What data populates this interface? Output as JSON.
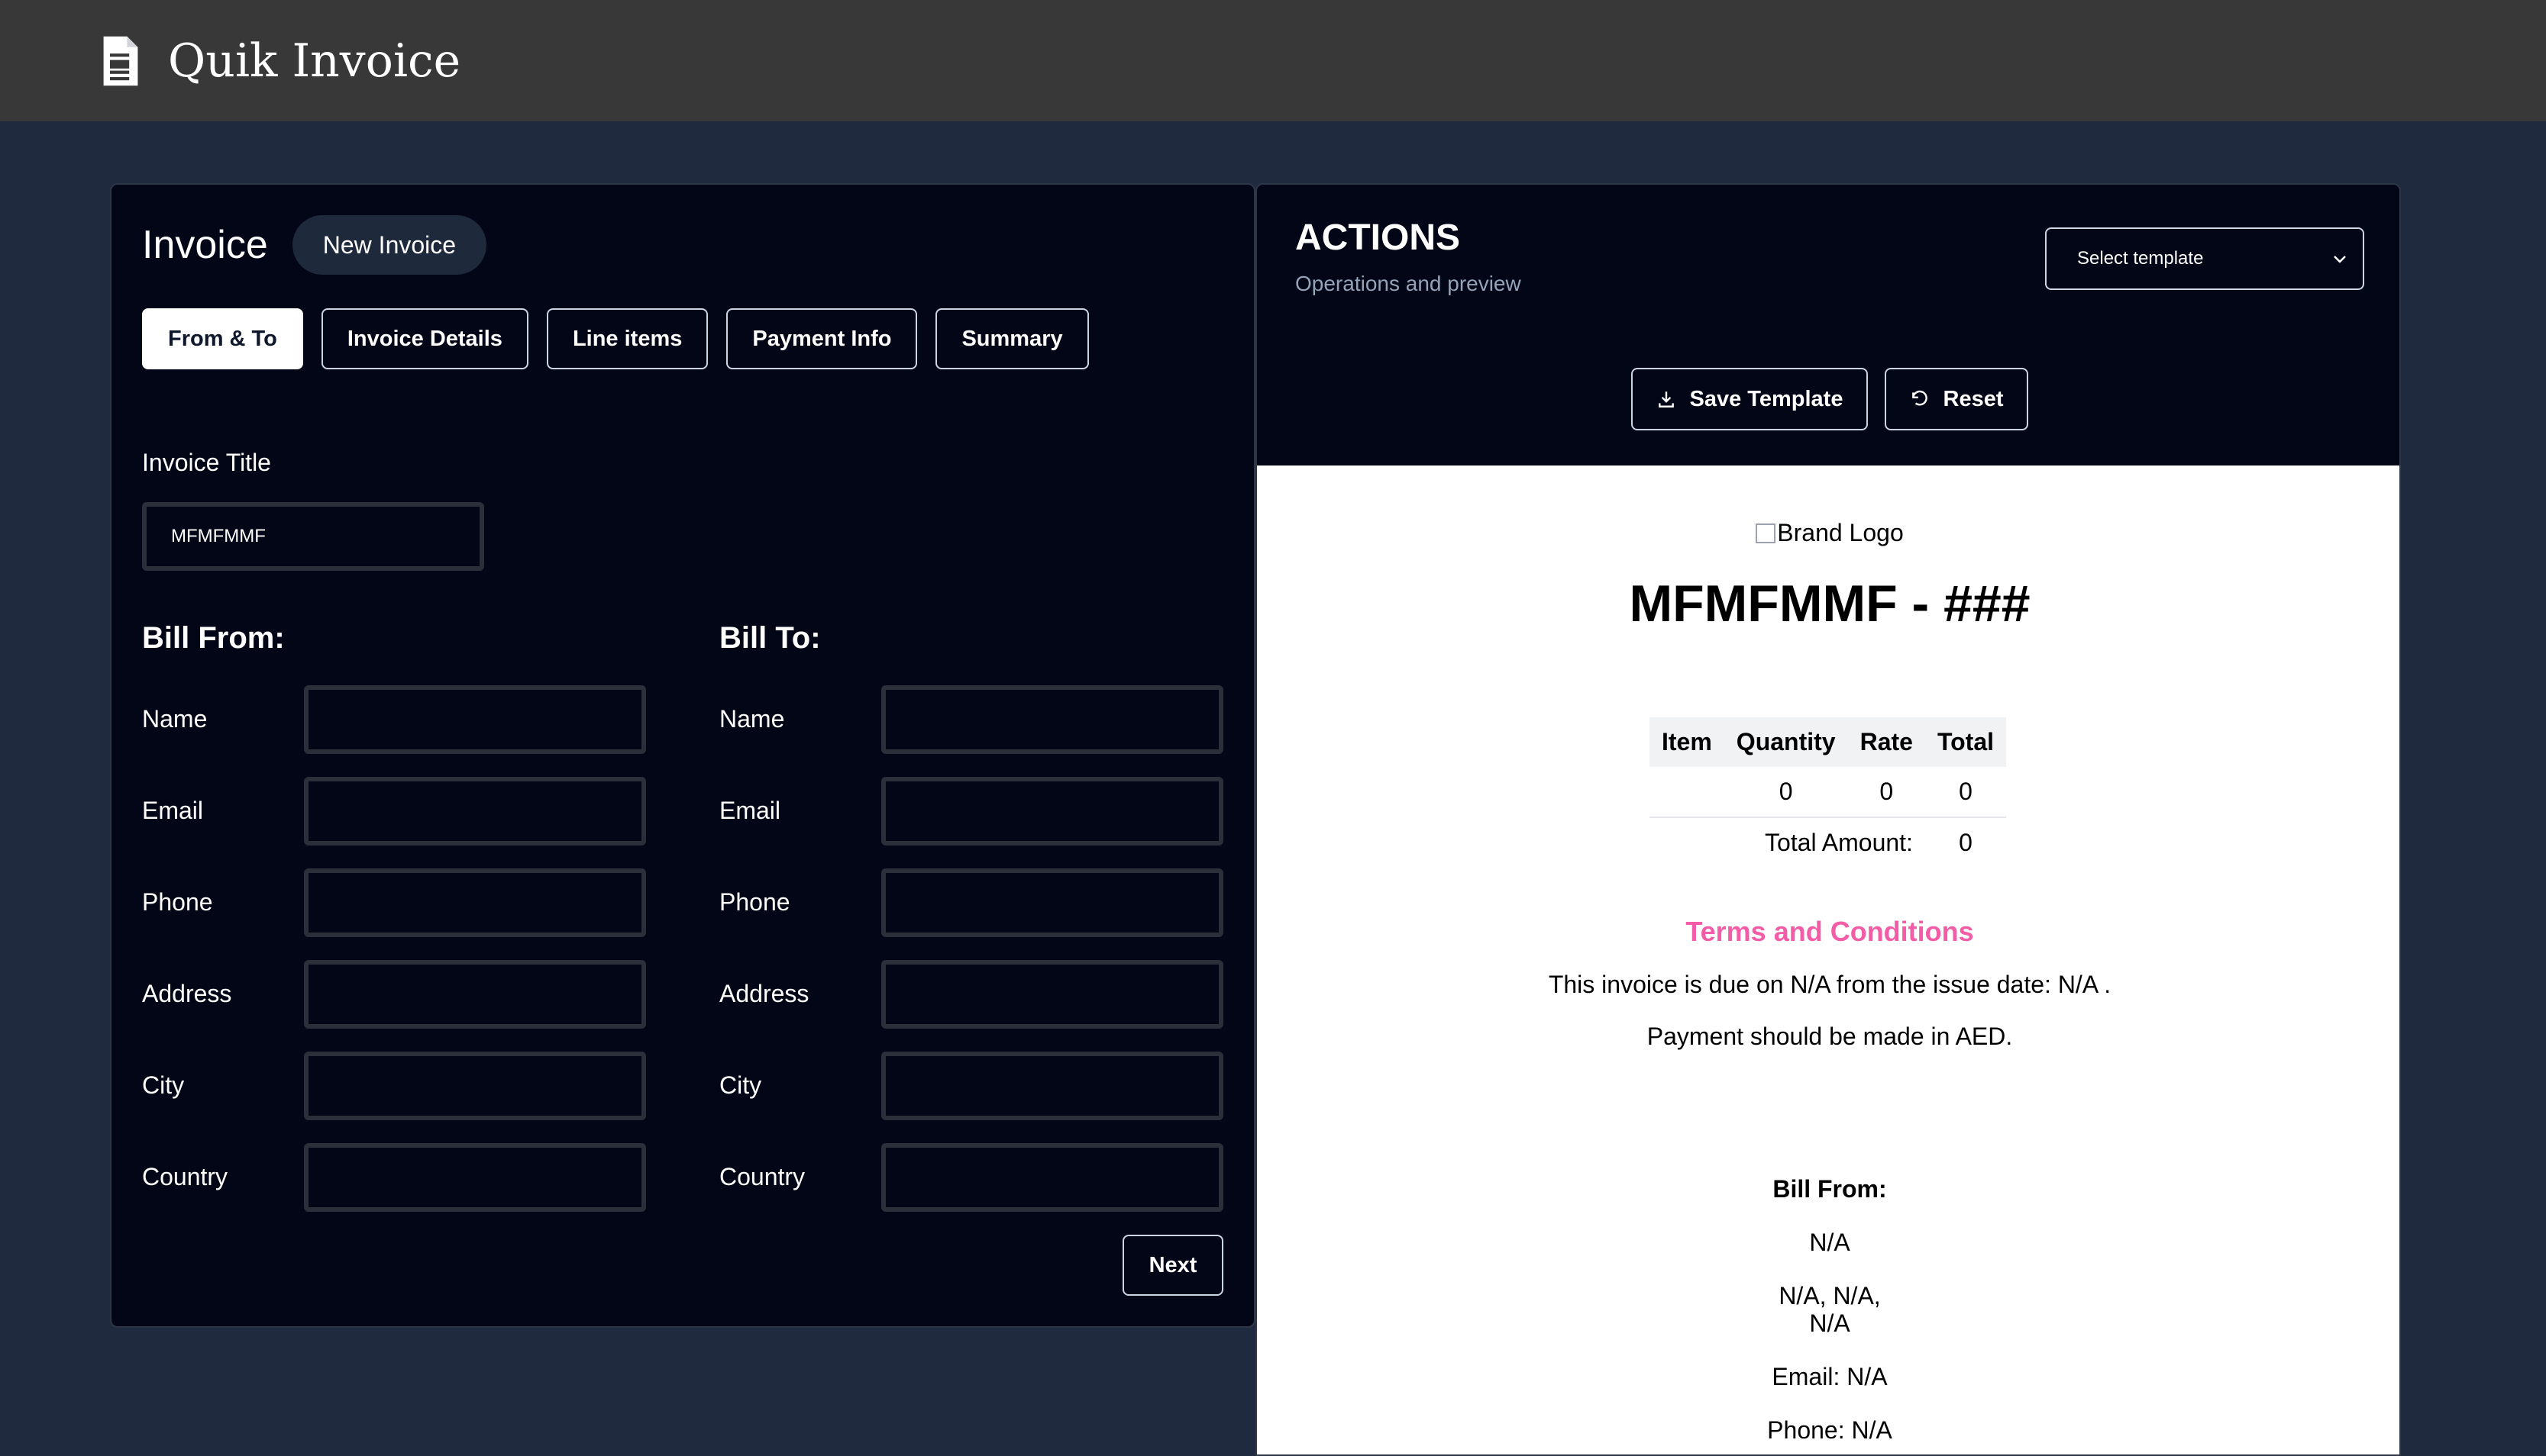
{
  "app": {
    "title": "Quik Invoice",
    "icon": "document-icon"
  },
  "form": {
    "title": "Invoice",
    "new_invoice_label": "New Invoice",
    "tabs": [
      "From & To",
      "Invoice Details",
      "Line items",
      "Payment Info",
      "Summary"
    ],
    "invoice_title_label": "Invoice Title",
    "invoice_title_value": "MFMFMMF",
    "bill_from_heading": "Bill From:",
    "bill_to_heading": "Bill To:",
    "fields": [
      "Name",
      "Email",
      "Phone",
      "Address",
      "City",
      "Country"
    ],
    "next_label": "Next"
  },
  "actions": {
    "title": "ACTIONS",
    "subtitle": "Operations and preview",
    "template_select": "Select template",
    "save_template_label": "Save Template",
    "reset_label": "Reset"
  },
  "preview": {
    "brand_logo_alt": "Brand Logo",
    "invoice_heading": "MFMFMMF - ###",
    "table": {
      "headers": [
        "Item",
        "Quantity",
        "Rate",
        "Total"
      ],
      "row": [
        "",
        "0",
        "0",
        "0"
      ],
      "total_label": "Total Amount:",
      "total_value": "0"
    },
    "terms_title": "Terms and Conditions",
    "terms_due": "This invoice is due on N/A from the issue date: N/A .",
    "terms_payment": "Payment should be made in AED.",
    "bill_from_heading": "Bill From:",
    "bill_from_name": "N/A",
    "bill_from_address_line1": "N/A, N/A,",
    "bill_from_address_line2": "N/A",
    "bill_from_email": "Email: N/A",
    "bill_from_phone": "Phone: N/A"
  },
  "colors": {
    "header_bg": "#383838",
    "page_bg": "#1f2a3e",
    "panel_bg": "#020617",
    "terms_accent": "#f35da7"
  }
}
